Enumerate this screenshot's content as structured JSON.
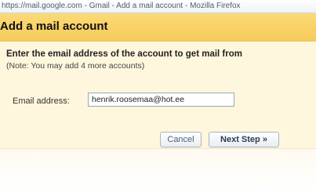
{
  "browser": {
    "title": "https://mail.google.com - Gmail - Add a mail account - Mozilla Firefox"
  },
  "dialog": {
    "title": "Add a mail account",
    "instruction": "Enter the email address of the account to get mail from",
    "note": "(Note: You may add 4 more accounts)",
    "email_label": "Email address:",
    "email_value": "henrik.roosemaa@hot.ee",
    "cancel_label": "Cancel",
    "next_label": "Next Step »"
  },
  "colors": {
    "header_bg": "#f6cc5a",
    "body_bg": "#fff7dd",
    "button_text": "#4c5f80"
  }
}
